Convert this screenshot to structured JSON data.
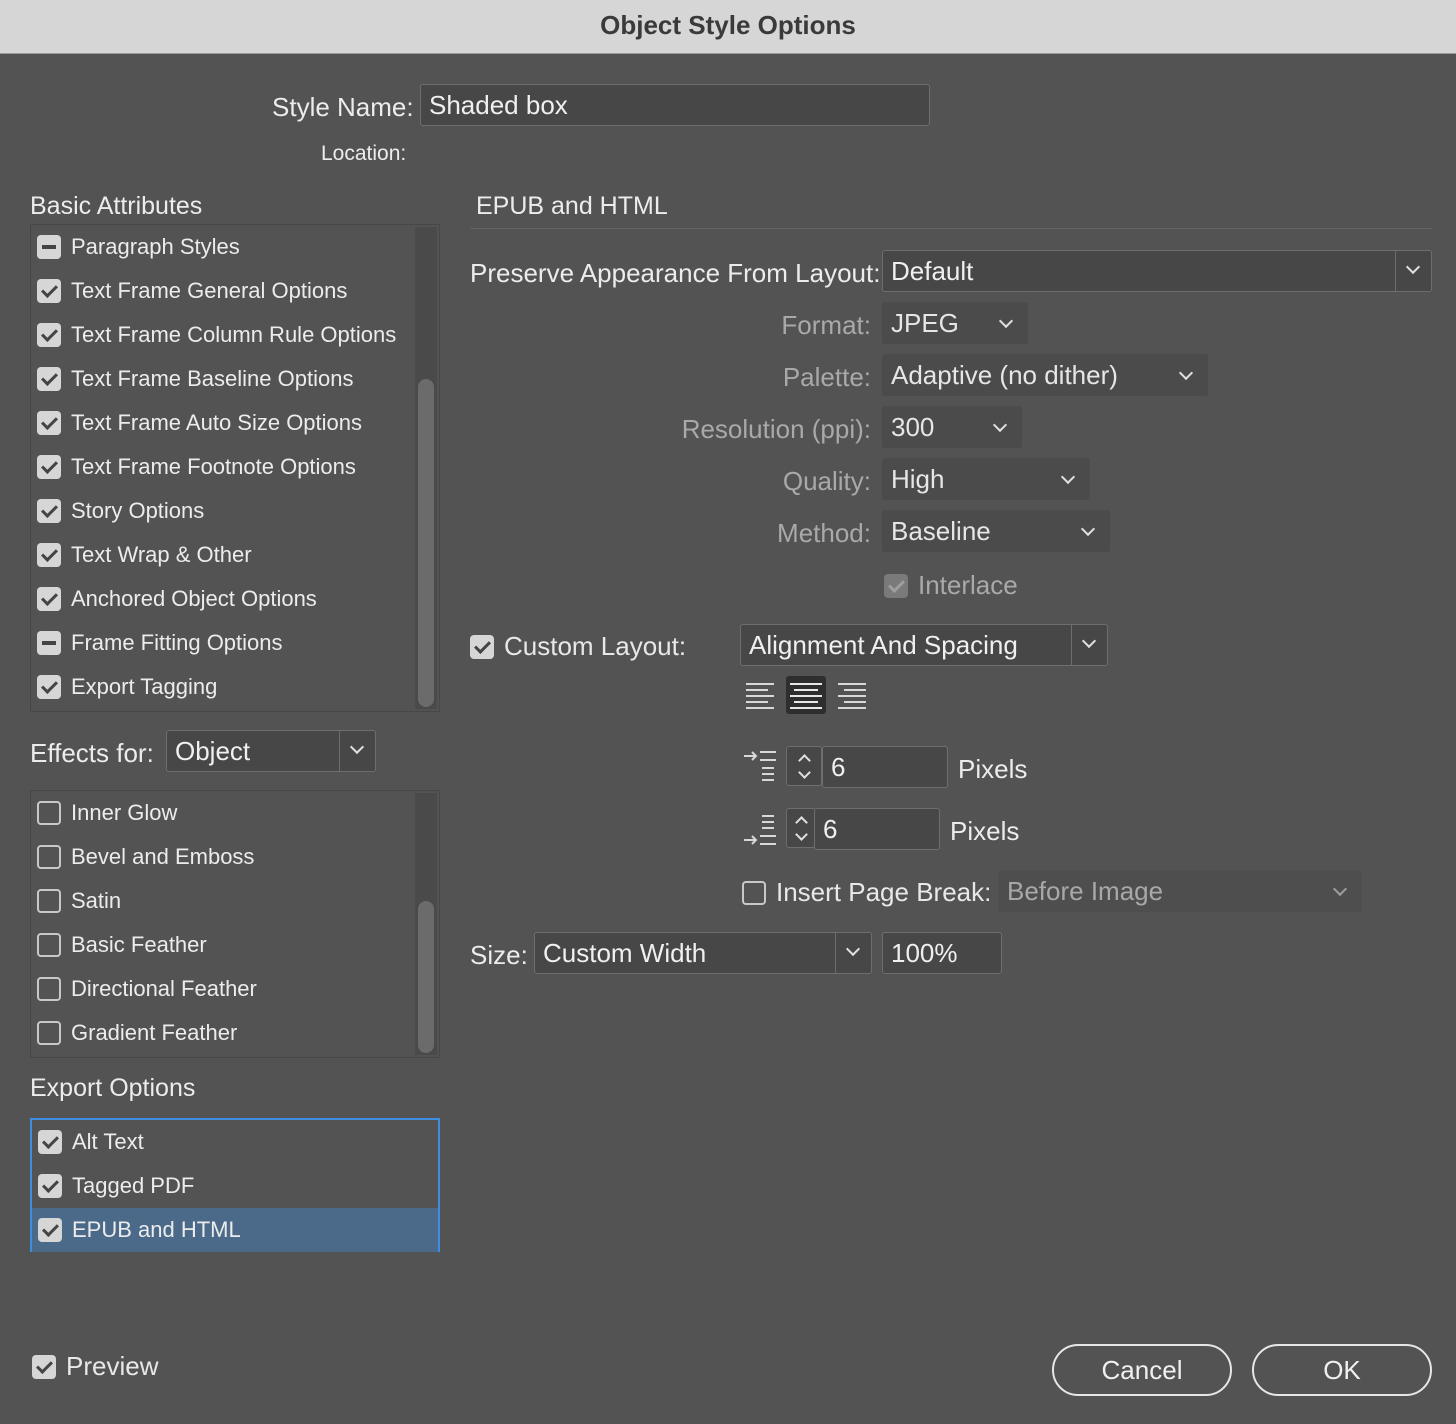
{
  "window": {
    "title": "Object Style Options"
  },
  "header": {
    "style_name_label": "Style Name:",
    "style_name_value": "Shaded box",
    "location_label": "Location:"
  },
  "basic_attributes": {
    "title": "Basic Attributes",
    "items": [
      {
        "label": "Paragraph Styles",
        "state": "mixed"
      },
      {
        "label": "Text Frame General Options",
        "state": "checked"
      },
      {
        "label": "Text Frame Column Rule Options",
        "state": "checked"
      },
      {
        "label": "Text Frame Baseline Options",
        "state": "checked"
      },
      {
        "label": "Text Frame Auto Size Options",
        "state": "checked"
      },
      {
        "label": "Text Frame Footnote Options",
        "state": "checked"
      },
      {
        "label": "Story Options",
        "state": "checked"
      },
      {
        "label": "Text Wrap & Other",
        "state": "checked"
      },
      {
        "label": "Anchored Object Options",
        "state": "checked"
      },
      {
        "label": "Frame Fitting Options",
        "state": "mixed"
      },
      {
        "label": "Export Tagging",
        "state": "checked"
      }
    ]
  },
  "effects": {
    "label": "Effects for:",
    "selected": "Object",
    "items": [
      {
        "label": "Inner Glow",
        "state": "empty"
      },
      {
        "label": "Bevel and Emboss",
        "state": "empty"
      },
      {
        "label": "Satin",
        "state": "empty"
      },
      {
        "label": "Basic Feather",
        "state": "empty"
      },
      {
        "label": "Directional Feather",
        "state": "empty"
      },
      {
        "label": "Gradient Feather",
        "state": "empty"
      }
    ]
  },
  "export_options": {
    "title": "Export Options",
    "items": [
      {
        "label": "Alt Text",
        "state": "checked"
      },
      {
        "label": "Tagged PDF",
        "state": "checked"
      },
      {
        "label": "EPUB and HTML",
        "state": "checked",
        "selected": true
      }
    ]
  },
  "panel": {
    "title": "EPUB and HTML",
    "preserve_label": "Preserve Appearance From Layout:",
    "preserve_value": "Default",
    "format_label": "Format:",
    "format_value": "JPEG",
    "palette_label": "Palette:",
    "palette_value": "Adaptive (no dither)",
    "resolution_label": "Resolution (ppi):",
    "resolution_value": "300",
    "quality_label": "Quality:",
    "quality_value": "High",
    "method_label": "Method:",
    "method_value": "Baseline",
    "interlace_label": "Interlace",
    "custom_layout_label": "Custom Layout:",
    "custom_layout_value": "Alignment And Spacing",
    "space_before_value": "6",
    "space_before_unit": "Pixels",
    "space_after_value": "6",
    "space_after_unit": "Pixels",
    "page_break_label": "Insert Page Break:",
    "page_break_value": "Before Image",
    "size_label": "Size:",
    "size_value": "Custom Width",
    "size_percent": "100%"
  },
  "footer": {
    "preview_label": "Preview",
    "cancel_label": "Cancel",
    "ok_label": "OK"
  },
  "colors": {
    "background": "#535353",
    "title_bar": "#d6d6d6",
    "selection": "#4b6a8a",
    "selection_border": "#3f8de0"
  }
}
